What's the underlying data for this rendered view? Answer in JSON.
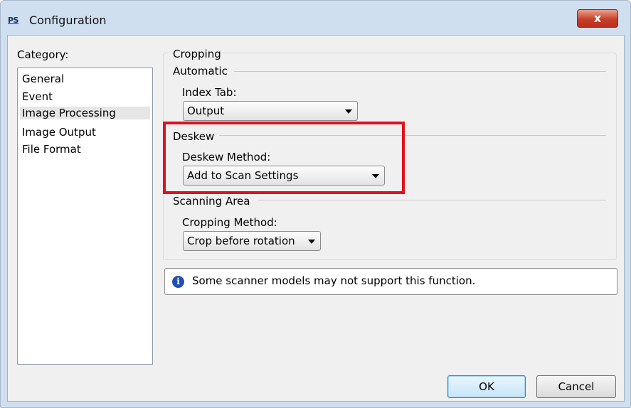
{
  "window": {
    "title": "Configuration",
    "app_icon_text": "PS",
    "close_label": "x"
  },
  "category": {
    "label": "Category:",
    "items": [
      {
        "label": "General"
      },
      {
        "label": "Event"
      },
      {
        "label": "Image Processing",
        "selected": true
      },
      {
        "label": "Image Output"
      },
      {
        "label": "File Format"
      }
    ]
  },
  "cropping": {
    "legend": "Cropping",
    "automatic": {
      "legend": "Automatic",
      "index_tab_label": "Index Tab:",
      "index_tab_value": "Output"
    },
    "deskew": {
      "legend": "Deskew",
      "method_label": "Deskew Method:",
      "method_value": "Add to Scan Settings"
    },
    "scanning_area": {
      "legend": "Scanning Area",
      "method_label": "Cropping Method:",
      "method_value": "Crop before rotation"
    }
  },
  "info": {
    "icon": "info-icon",
    "text": "Some scanner models may not support this function."
  },
  "buttons": {
    "ok": "OK",
    "cancel": "Cancel"
  },
  "colors": {
    "highlight": "#e0101c",
    "selection": "#e6e6e6",
    "info_icon": "#1f4fb5"
  }
}
